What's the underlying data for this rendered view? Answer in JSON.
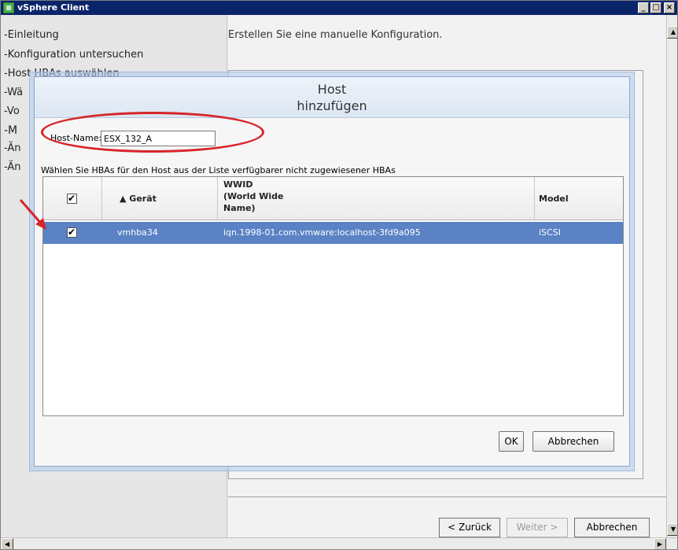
{
  "window": {
    "title": "vSphere Client",
    "minimize": "_",
    "maximize": "□",
    "close": "×"
  },
  "wizard": {
    "nav_items": [
      "-Einleitung",
      "-Konfiguration untersuchen",
      "-Host HBAs auswählen",
      "-Wä",
      "-Vo",
      "-M",
      "-Än",
      "-Än"
    ],
    "heading": "Erstellen Sie eine manuelle Konfiguration.",
    "back_button": "< Zurück",
    "next_button": "Weiter >",
    "cancel_button": "Abbrechen"
  },
  "dialog": {
    "title_line1": "Host",
    "title_line2": "hinzufügen",
    "hostname_label": "Host-Name:",
    "hostname_value": "ESX_132_A",
    "instruction": "Wählen Sie HBAs für den Host aus der Liste verfügbarer nicht zugewiesener HBAs",
    "table": {
      "columns": {
        "device": "▲ Gerät",
        "wwid_line1": "WWID",
        "wwid_line2": "(World Wide",
        "wwid_line3": "Name)",
        "model": "Model"
      },
      "rows": [
        {
          "checked": true,
          "device": "vmhba34",
          "wwid": "iqn.1998-01.com.vmware:localhost-3fd9a095",
          "model": "iSCSI"
        }
      ]
    },
    "ok_button": "OK",
    "cancel_button": "Abbrechen"
  },
  "colors": {
    "selection": "#5a82c5",
    "annotation": "#d6252a",
    "titlebar": "#0a246a"
  }
}
